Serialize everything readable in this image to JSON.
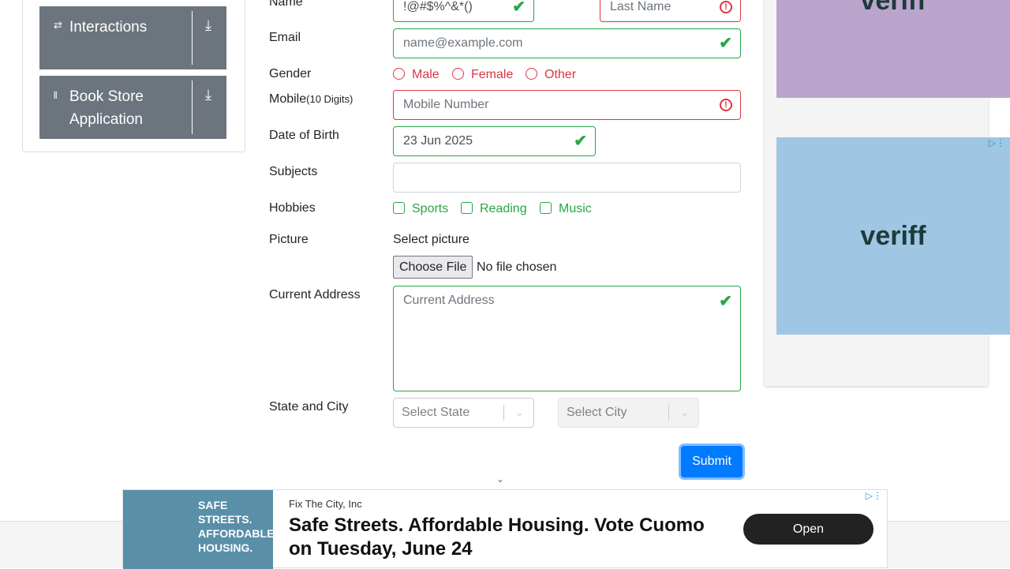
{
  "sidebar": {
    "groups": [
      {
        "label": "Interactions",
        "icon": "swap-icon"
      },
      {
        "label": "Book Store Application",
        "icon": "books-icon"
      }
    ]
  },
  "form": {
    "name": {
      "label": "Name",
      "first_value": "!@#$%^&*()",
      "last_placeholder": "Last Name"
    },
    "email": {
      "label": "Email",
      "placeholder": "name@example.com"
    },
    "gender": {
      "label": "Gender",
      "options": [
        "Male",
        "Female",
        "Other"
      ]
    },
    "mobile": {
      "label": "Mobile",
      "hint": "(10 Digits)",
      "placeholder": "Mobile Number"
    },
    "dob": {
      "label": "Date of Birth",
      "value": "23 Jun 2025"
    },
    "subjects": {
      "label": "Subjects"
    },
    "hobbies": {
      "label": "Hobbies",
      "options": [
        "Sports",
        "Reading",
        "Music"
      ]
    },
    "picture": {
      "label": "Picture",
      "select_label": "Select picture",
      "button": "Choose File",
      "status": "No file chosen"
    },
    "address": {
      "label": "Current Address",
      "placeholder": "Current Address"
    },
    "state_city": {
      "label": "State and City",
      "state_placeholder": "Select State",
      "city_placeholder": "Select City"
    },
    "submit": "Submit"
  },
  "colors": {
    "valid": "#28a745",
    "invalid": "#dc3545",
    "primary": "#007bff",
    "sidebar": "#6c757d"
  },
  "side_ad": {
    "brand": "veriff"
  },
  "bottom_ad": {
    "advertiser": "Fix The City, Inc",
    "headline": "Safe Streets. Affordable Housing. Vote Cuomo on Tuesday, June 24",
    "cta": "Open",
    "image_text": "SAFE STREETS. AFFORDABLE HOUSING."
  }
}
